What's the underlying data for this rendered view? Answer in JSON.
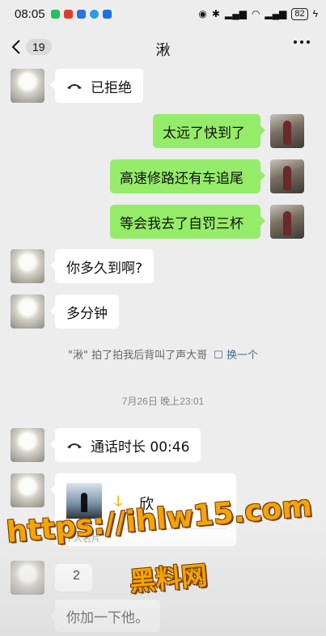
{
  "status_bar": {
    "time": "08:05",
    "battery": "82",
    "app_icons": [
      {
        "name": "wechat-icon",
        "color": "#22c15e"
      },
      {
        "name": "app-red-icon",
        "color": "#e23b2e"
      },
      {
        "name": "app-blue-icon",
        "color": "#2f6fe0"
      },
      {
        "name": "app-cyan-icon",
        "color": "#2b9fe6"
      },
      {
        "name": "app-blue2-icon",
        "color": "#1e6ee8"
      }
    ]
  },
  "nav": {
    "unread_count": "19",
    "title": "湫"
  },
  "messages": [
    {
      "side": "left",
      "text": "已拒绝",
      "icon": "phone-hangup-icon"
    },
    {
      "side": "right",
      "text": "太远了快到了"
    },
    {
      "side": "right",
      "text": "高速修路还有车追尾"
    },
    {
      "side": "right",
      "text": "等会我去了自罚三杯"
    },
    {
      "side": "left",
      "text": "你多久到啊?"
    },
    {
      "side": "left",
      "text": "多分钟"
    }
  ],
  "pat": {
    "text": "\"湫\" 拍了拍我后背叫了声大哥",
    "link": "换一个"
  },
  "timestamp": "7月26日 晚上23:01",
  "call": {
    "text": "通话时长 00:46",
    "icon": "phone-hangup-icon"
  },
  "card": {
    "name": "欣",
    "label": "个人名片"
  },
  "partial_message": "2",
  "last_message": "你加一下他。",
  "watermark": {
    "url": "https://ihlw15.com",
    "cn": "黑料网"
  }
}
